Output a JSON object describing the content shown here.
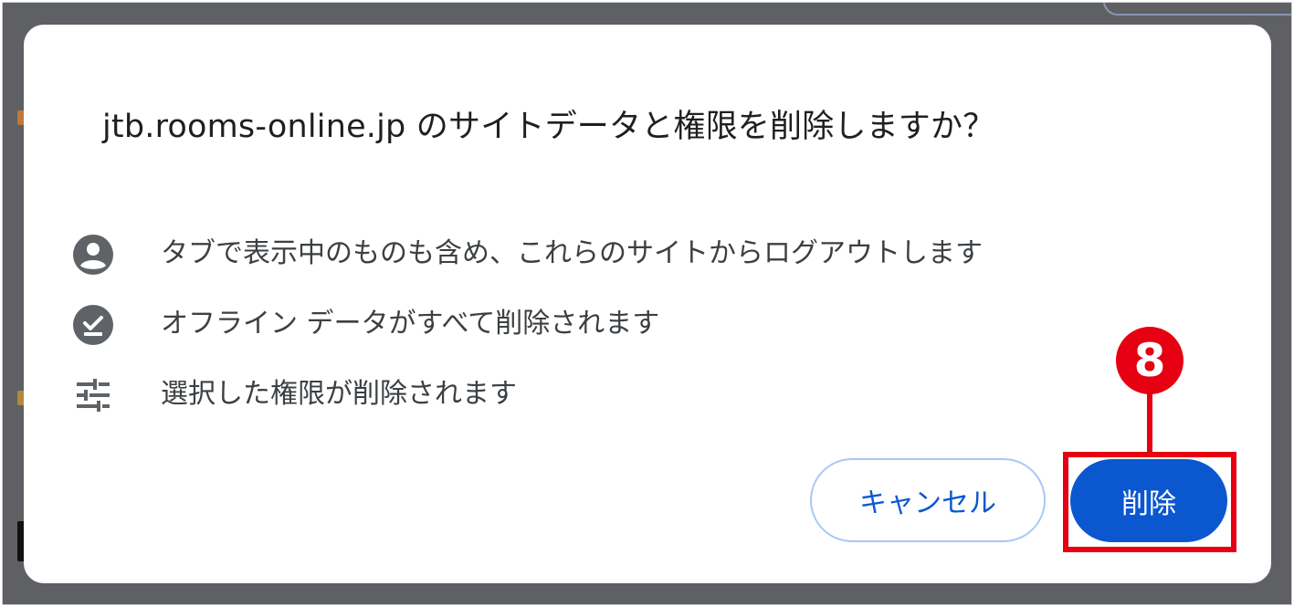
{
  "dialog": {
    "title": "jtb.rooms-online.jp のサイトデータと権限を削除しますか？",
    "items": [
      {
        "icon": "account-circle-icon",
        "text": "タブで表示中のものも含め、これらのサイトからログアウトします"
      },
      {
        "icon": "offline-check-icon",
        "text": "オフライン データがすべて削除されます"
      },
      {
        "icon": "tune-sliders-icon",
        "text": "選択した権限が削除されます"
      }
    ],
    "cancel_label": "キャンセル",
    "delete_label": "削除"
  },
  "annotation": {
    "step_number": "8",
    "color": "#e60012"
  },
  "colors": {
    "primary": "#0b57d0",
    "cancel_border": "#a8c7fa",
    "icon": "#5f6368",
    "overlay": "#5f6063"
  }
}
